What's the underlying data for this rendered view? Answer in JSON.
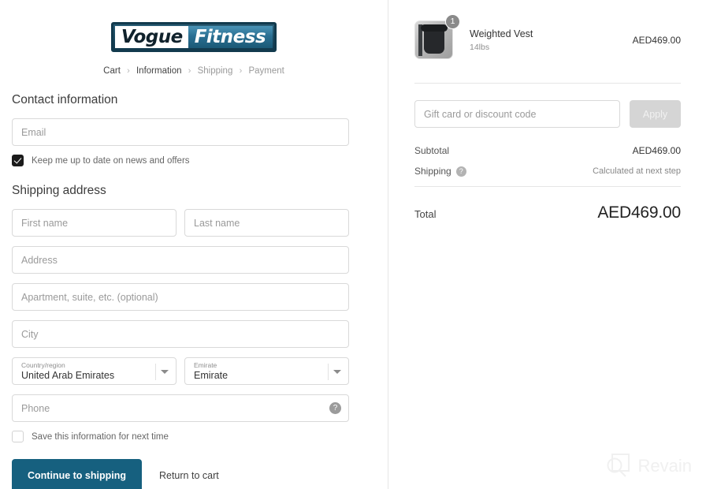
{
  "brand": {
    "logo_left": "Vogue",
    "logo_right": "Fitness"
  },
  "breadcrumb": {
    "items": [
      {
        "label": "Cart",
        "state": "active"
      },
      {
        "label": "Information",
        "state": "active"
      },
      {
        "label": "Shipping",
        "state": "muted"
      },
      {
        "label": "Payment",
        "state": "muted"
      }
    ],
    "separator": "›"
  },
  "contact": {
    "title": "Contact information",
    "email_placeholder": "Email",
    "newsletter_label": "Keep me up to date on news and offers",
    "newsletter_checked": true
  },
  "shipping": {
    "title": "Shipping address",
    "first_name_placeholder": "First name",
    "last_name_placeholder": "Last name",
    "address_placeholder": "Address",
    "apartment_placeholder": "Apartment, suite, etc. (optional)",
    "city_placeholder": "City",
    "country_label": "Country/region",
    "country_value": "United Arab Emirates",
    "emirate_label": "Emirate",
    "emirate_value": "Emirate",
    "phone_placeholder": "Phone",
    "phone_help_glyph": "?",
    "save_label": "Save this information for next time",
    "save_checked": false
  },
  "actions": {
    "continue_label": "Continue to shipping",
    "return_label": "Return to cart",
    "primary_color": "#16607f"
  },
  "summary": {
    "product": {
      "name": "Weighted Vest",
      "variant": "14lbs",
      "price": "AED469.00",
      "quantity": "1"
    },
    "discount": {
      "placeholder": "Gift card or discount code",
      "apply_label": "Apply"
    },
    "subtotal_label": "Subtotal",
    "subtotal_value": "AED469.00",
    "shipping_label": "Shipping",
    "shipping_help_glyph": "?",
    "shipping_value": "Calculated at next step",
    "total_label": "Total",
    "total_value": "AED469.00"
  },
  "watermark": {
    "text": "Revain"
  }
}
